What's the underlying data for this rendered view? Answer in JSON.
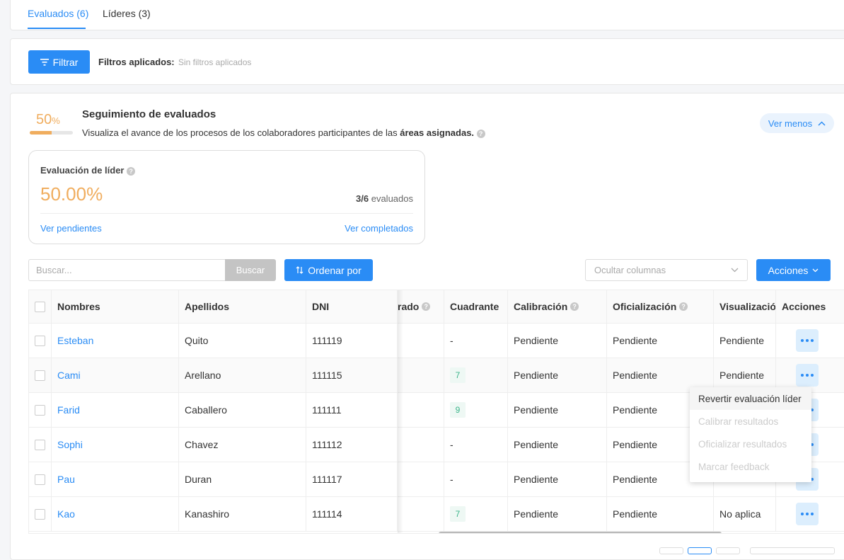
{
  "tabs": [
    {
      "label": "Evaluados (6)",
      "active": true
    },
    {
      "label": "Líderes (3)",
      "active": false
    }
  ],
  "filters": {
    "button_label": "Filtrar",
    "applied_label": "Filtros aplicados:",
    "applied_value": "Sin filtros aplicados"
  },
  "tracking": {
    "percent_value": "50",
    "percent_symbol": "%",
    "progress": 0.5,
    "title": "Seguimiento de evaluados",
    "description_prefix": "Visualiza el avance de los procesos de los colaboradores participantes de las ",
    "description_bold": "áreas asignadas.",
    "toggle_label": "Ver menos"
  },
  "leader_card": {
    "title": "Evaluación de líder",
    "percent": "50.00%",
    "count_bold": "3/6",
    "count_suffix": " evaluados",
    "link_pending": "Ver pendientes",
    "link_completed": "Ver completados"
  },
  "toolbar": {
    "search_placeholder": "Buscar...",
    "search_button": "Buscar",
    "sort_button": "Ordenar por",
    "hide_columns_placeholder": "Ocultar columnas",
    "actions_button": "Acciones"
  },
  "table": {
    "headers": {
      "nombres": "Nombres",
      "apellidos": "Apellidos",
      "dni": "DNI",
      "partial": "rado",
      "cuadrante": "Cuadrante",
      "calibracion": "Calibración",
      "oficializacion": "Oficialización",
      "visualizacion": "Visualizació",
      "acciones": "Acciones"
    },
    "rows": [
      {
        "nombre": "Esteban",
        "apellido": "Quito",
        "dni": "111119",
        "cuadrante": "-",
        "calibracion": "Pendiente",
        "oficializacion": "Pendiente",
        "visualizacion": "Pendiente"
      },
      {
        "nombre": "Cami",
        "apellido": "Arellano",
        "dni": "111115",
        "cuadrante": "7",
        "calibracion": "Pendiente",
        "oficializacion": "Pendiente",
        "visualizacion": "Pendiente"
      },
      {
        "nombre": "Farid",
        "apellido": "Caballero",
        "dni": "111111",
        "cuadrante": "9",
        "calibracion": "Pendiente",
        "oficializacion": "Pendiente",
        "visualizacion": ""
      },
      {
        "nombre": "Sophi",
        "apellido": "Chavez",
        "dni": "111112",
        "cuadrante": "-",
        "calibracion": "Pendiente",
        "oficializacion": "Pendiente",
        "visualizacion": ""
      },
      {
        "nombre": "Pau",
        "apellido": "Duran",
        "dni": "111117",
        "cuadrante": "-",
        "calibracion": "Pendiente",
        "oficializacion": "Pendiente",
        "visualizacion": ""
      },
      {
        "nombre": "Kao",
        "apellido": "Kanashiro",
        "dni": "111114",
        "cuadrante": "7",
        "calibracion": "Pendiente",
        "oficializacion": "Pendiente",
        "visualizacion": "No aplica"
      }
    ]
  },
  "context_menu": [
    {
      "label": "Revertir evaluación líder",
      "enabled": true
    },
    {
      "label": "Calibrar resultados",
      "enabled": false
    },
    {
      "label": "Oficializar resultados",
      "enabled": false
    },
    {
      "label": "Marcar feedback",
      "enabled": false
    }
  ],
  "colors": {
    "accent": "#2a8cf5",
    "progress": "#f0ad5e",
    "badge_text": "#3bb58a"
  }
}
